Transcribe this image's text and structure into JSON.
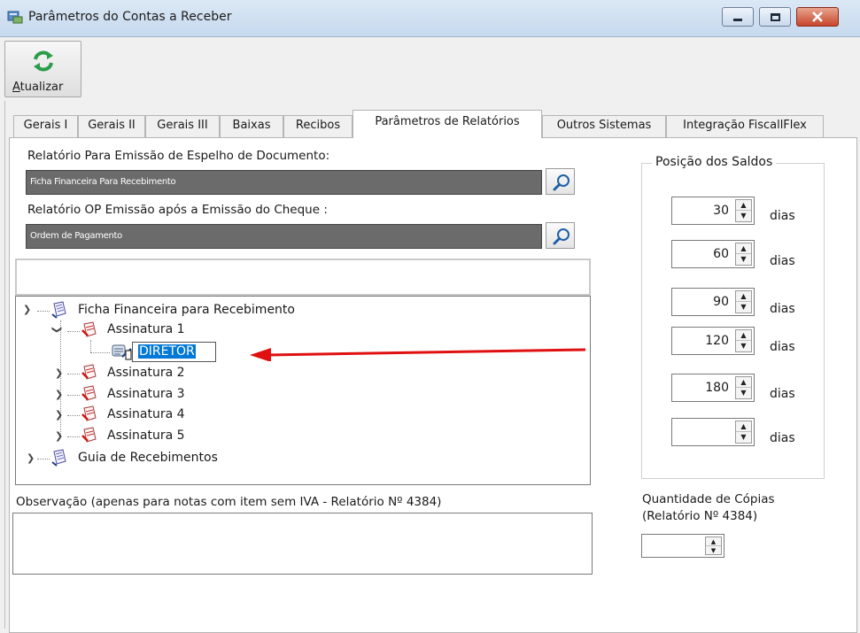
{
  "window": {
    "title": "Parâmetros do Contas a Receber"
  },
  "toolbar": {
    "refresh_label_first": "A",
    "refresh_label_rest": "tualizar"
  },
  "tabs": [
    {
      "label": "Gerais I"
    },
    {
      "label": "Gerais II"
    },
    {
      "label": "Gerais III"
    },
    {
      "label": "Baixas"
    },
    {
      "label": "Recibos"
    },
    {
      "label": "Parâmetros de Relatórios",
      "active": true
    },
    {
      "label": "Outros Sistemas"
    },
    {
      "label": "Integração FiscallFlex"
    }
  ],
  "reports": {
    "espelho_label": "Relatório Para Emissão de Espelho de Documento:",
    "espelho_value": "Ficha Financeira Para Recebimento",
    "op_label": "Relatório OP Emissão após a Emissão do Cheque :",
    "op_value": "Ordem de Pagamento"
  },
  "tree": {
    "root1": "Ficha Financeira para Recebimento",
    "sig1": "Assinatura 1",
    "editing_value": "DIRETOR",
    "sig2": "Assinatura 2",
    "sig3": "Assinatura 3",
    "sig4": "Assinatura 4",
    "sig5": "Assinatura 5",
    "root2": "Guia de Recebimentos"
  },
  "observation": {
    "label": "Observação (apenas para notas com item sem IVA - Relatório Nº 4384)",
    "value": ""
  },
  "saldos": {
    "legend": "Posição dos Saldos",
    "unit": "dias",
    "values": [
      "30",
      "60",
      "90",
      "120",
      "180",
      ""
    ]
  },
  "copies": {
    "label_line1": "Quantidade de Cópias",
    "label_line2": "(Relatório Nº 4384)",
    "value": ""
  },
  "colors": {
    "selection": "#0078d7",
    "annotation_arrow": "#e01010"
  }
}
